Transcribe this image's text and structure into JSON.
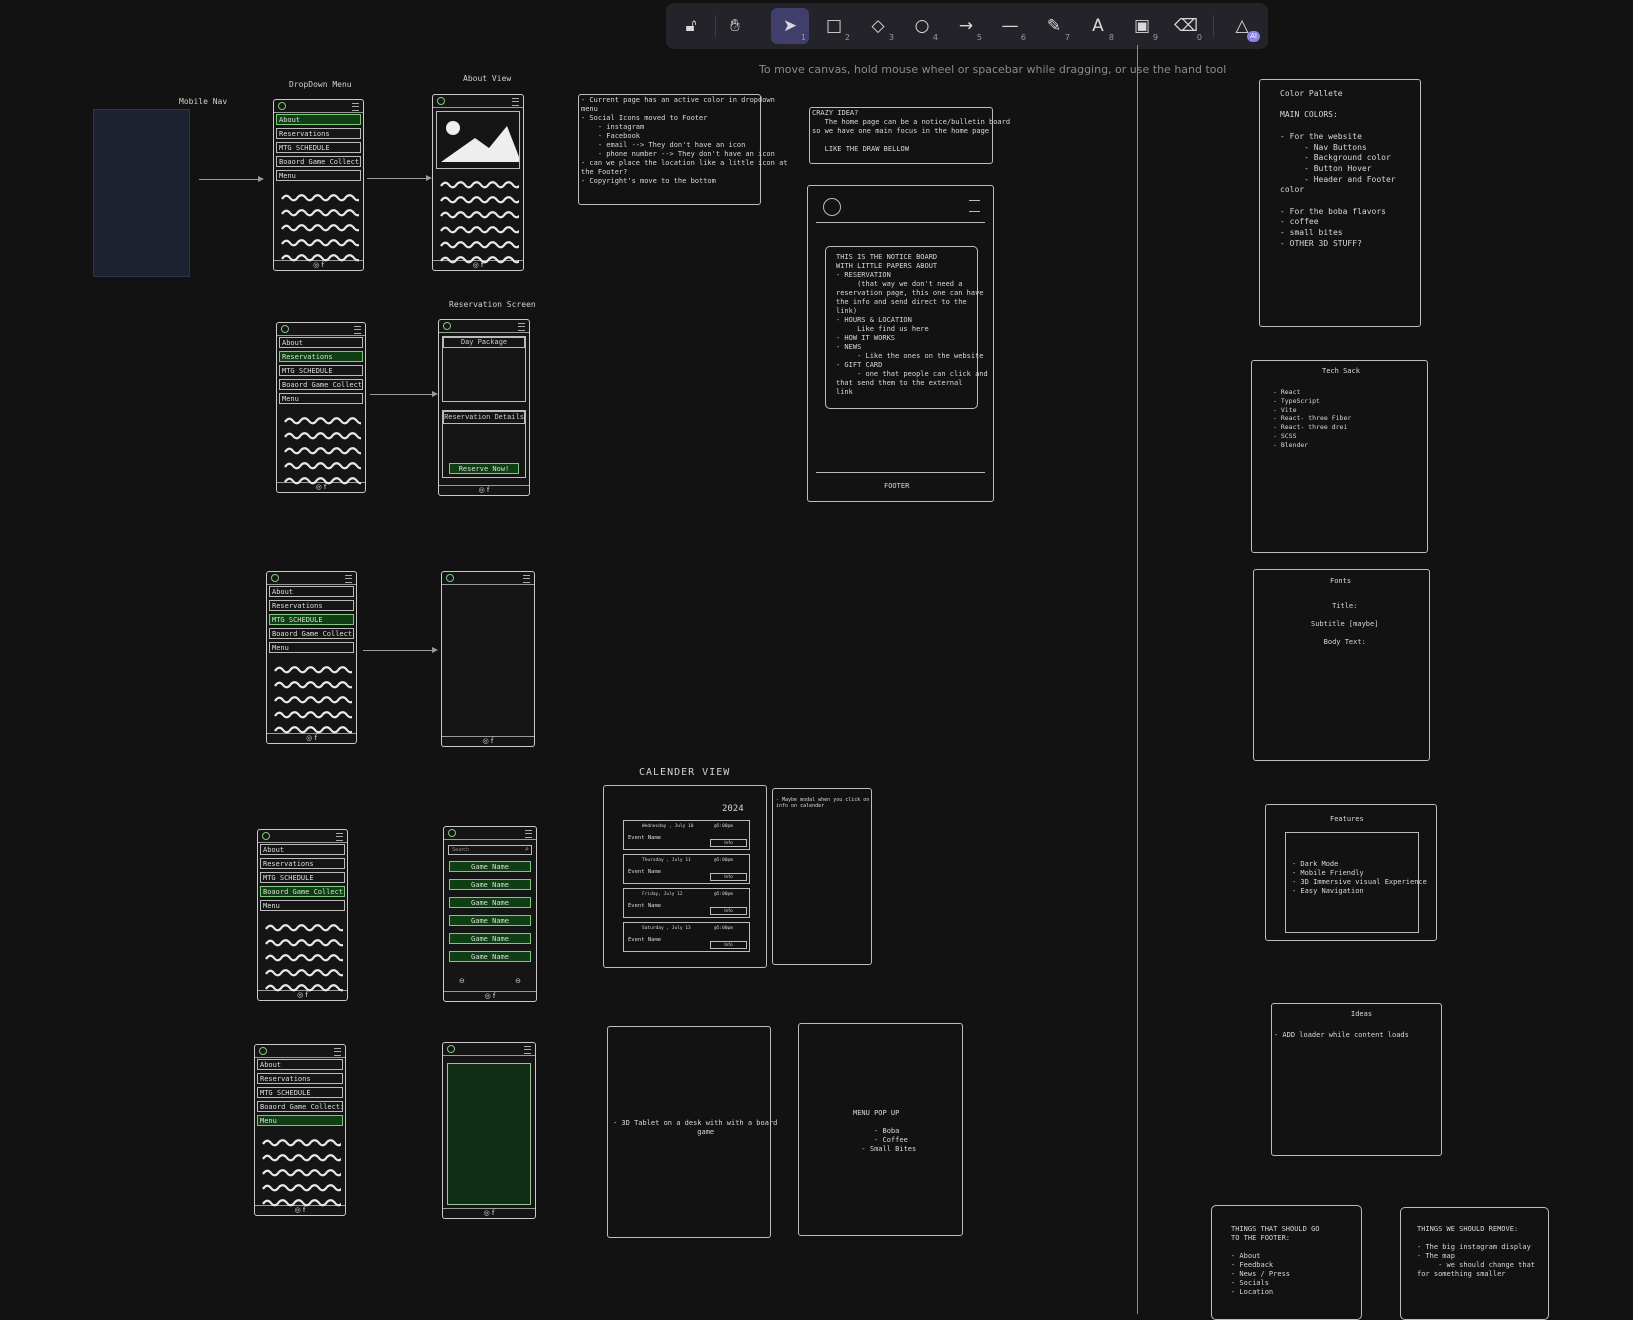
{
  "toolbar": {
    "tools": [
      {
        "icon": "lock-open-icon",
        "glyph": "🔓︎",
        "num": ""
      },
      {
        "icon": "hand-icon",
        "glyph": "✋︎",
        "num": ""
      },
      {
        "icon": "pointer-icon",
        "glyph": "➤",
        "num": "1"
      },
      {
        "icon": "rectangle-icon",
        "glyph": "□",
        "num": "2"
      },
      {
        "icon": "diamond-icon",
        "glyph": "◇",
        "num": "3"
      },
      {
        "icon": "ellipse-icon",
        "glyph": "○",
        "num": "4"
      },
      {
        "icon": "arrow-icon",
        "glyph": "→",
        "num": "5"
      },
      {
        "icon": "line-icon",
        "glyph": "—",
        "num": "6"
      },
      {
        "icon": "pencil-icon",
        "glyph": "✎",
        "num": "7"
      },
      {
        "icon": "text-icon",
        "glyph": "A",
        "num": "8"
      },
      {
        "icon": "image-icon",
        "glyph": "▣",
        "num": "9"
      },
      {
        "icon": "eraser-icon",
        "glyph": "⌫",
        "num": "0"
      },
      {
        "icon": "shapes-library-icon",
        "glyph": "△",
        "num": ""
      }
    ],
    "ai_badge": "AI"
  },
  "hint": "To move canvas, hold mouse wheel or spacebar while dragging, or use the hand tool",
  "labels": {
    "mobile_nav": "Mobile Nav",
    "dropdown_menu": "DropDown Menu",
    "about_view": "About View",
    "reservation_screen": "Reservation Screen",
    "calendar_view": "CALENDER VIEW"
  },
  "menu": [
    "About",
    "Reservations",
    "MTG SCHEDULE",
    "Boaord Game Collection",
    "Menu"
  ],
  "footer_icons": "◎ f",
  "reservation": {
    "day_package": "Day Package",
    "details": "Reservation Details",
    "reserve": "Reserve Now!"
  },
  "games": {
    "search": "Search",
    "items": [
      "Game Name",
      "Game Name",
      "Game Name",
      "Game Name",
      "Game Name",
      "Game Name"
    ]
  },
  "notes": {
    "current_page": "- Current page has an active color in dropdown\nmenu\n- Social Icons moved to Footer\n    - instagram\n    - Facebook\n    - email --> They don't have an icon\n    - phone number --> They don't have an icon\n- can we place the location like a little icon at\nthe Footer?\n- Copyright's move to the bottom",
    "crazy_idea": "CRAZY IDEA?\n   The home page can be a notice/bulletin board\nso we have one main focus in the home page\n\n   LIKE THE DRAW BELLOW",
    "notice_board": "THIS IS THE NOTICE BOARD\nWITH LITTLE PAPERS ABOUT\n- RESERVATION\n     (that way we don't need a\nreservation page, this one can have\nthe info and send direct to the\nlink)\n- HOURS & LOCATION\n     Like find us here\n- HOW IT WORKS\n- NEWS\n     - Like the ones on the website\n- GIFT CARD\n     - one that people can click and\nthat send them to the external\nlink",
    "footer": "FOOTER",
    "calendar_year": "2024",
    "calendar_events": [
      {
        "date": "Wednesday , July 10",
        "time": "@5:00pm",
        "name": "Event Name",
        "btn": "Info"
      },
      {
        "date": "Thursday , July 11",
        "time": "@5:00pm",
        "name": "Event Name",
        "btn": "Info"
      },
      {
        "date": "Friday, July 12",
        "time": "@5:00pm",
        "name": "Event Name",
        "btn": "Info"
      },
      {
        "date": "Saturday , July 13",
        "time": "@5:00pm",
        "name": "Event Name",
        "btn": "Info"
      }
    ],
    "calendar_modal": "- Maybe modal when you click on\ninfo on calender",
    "tablet": "- 3D Tablet on a desk with with a board\n                    game",
    "menu_popup": "MENU POP UP\n\n     - Boba\n     - Coffee\n  - Small Bites",
    "color_pallete": "Color Pallete\n\nMAIN COLORS:\n\n- For the website\n     - Nav Buttons\n     - Background color\n     - Button Hover\n     - Header and Footer\ncolor\n\n- For the boba flavors\n- coffee\n- small bites\n- OTHER 3D STUFF?",
    "tech_stack_title": "Tech Sack",
    "tech_stack": "- React\n- TypeScript\n- Vite\n- React- three Fiber\n- React- three drei\n- SCSS\n- Blender",
    "fonts_title": "Fonts",
    "fonts": "Title:\n\nSubtitle [maybe]\n\nBody Text:",
    "features_title": "Features",
    "features": "- Dark Mode\n- Mobile Friendly\n- 3D Immersive visual Experience\n- Easy Navigation",
    "ideas_title": "Ideas",
    "ideas": "- ADD loader while content loads",
    "footer_list": "THINGS THAT SHOULD GO\nTO THE FOOTER:\n\n- About\n- Feedback\n- News / Press\n- Socials\n- Location",
    "remove_list": "THINGS WE SHOULD REMOVE:\n\n- The big instagram display\n- The map\n     - we should change that\nfor something smaller"
  }
}
